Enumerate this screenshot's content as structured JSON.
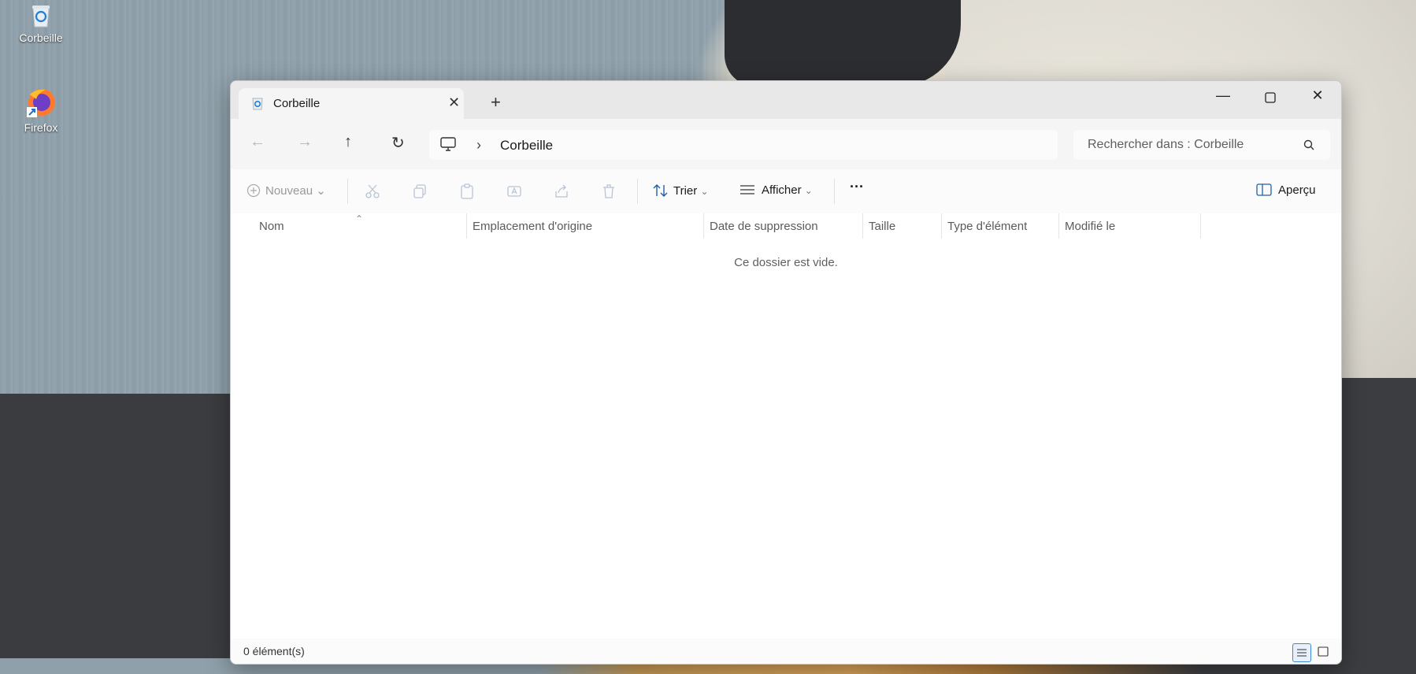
{
  "desktop": {
    "icons": [
      {
        "label": "Corbeille",
        "icon": "recycle-bin-icon"
      },
      {
        "label": "Firefox",
        "icon": "firefox-icon"
      }
    ]
  },
  "window": {
    "tab_title": "Corbeille",
    "new_tab_symbol": "+",
    "nav": {
      "back": "←",
      "forward": "→",
      "up": "↑",
      "refresh": "↻"
    },
    "breadcrumb": {
      "separator": "›",
      "current": "Corbeille"
    },
    "search_placeholder": "Rechercher dans : Corbeille",
    "toolbar": {
      "new_label": "Nouveau",
      "sort_label": "Trier",
      "view_label": "Afficher",
      "more_label": "···",
      "preview_label": "Aperçu"
    },
    "columns": [
      "Nom",
      "Emplacement d'origine",
      "Date de suppression",
      "Taille",
      "Type d'élément",
      "Modifié le"
    ],
    "empty_message": "Ce dossier est vide.",
    "status_count": "0 élément(s)"
  },
  "colors": {
    "accent": "#3a88d8",
    "disabled": "#b5b5b5"
  }
}
